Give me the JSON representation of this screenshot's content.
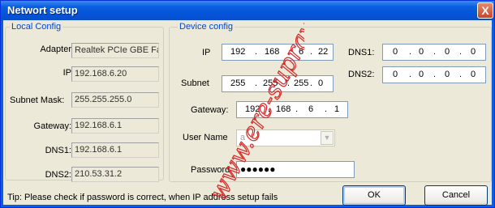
{
  "window": {
    "title": "Networt setup",
    "close_label": "X"
  },
  "local": {
    "legend": "Local Config",
    "fields": [
      {
        "label": "Adapter",
        "value": "Realtek PCIe GBE Fan"
      },
      {
        "label": "IP",
        "value": "192.168.6.20"
      },
      {
        "label": "Subnet Mask:",
        "value": "255.255.255.0"
      },
      {
        "label": "Gateway:",
        "value": "192.168.6.1"
      },
      {
        "label": "DNS1:",
        "value": "192.168.6.1"
      },
      {
        "label": "DNS2:",
        "value": "210.53.31.2"
      }
    ]
  },
  "device": {
    "legend": "Device config",
    "ip_label": "IP",
    "ip": [
      "192",
      "168",
      "6",
      "22"
    ],
    "subnet_label": "Subnet",
    "subnet": [
      "255",
      "255",
      "255",
      "0"
    ],
    "gateway_label": "Gateway:",
    "gateway": [
      "192",
      "168",
      "6",
      "1"
    ],
    "dns1_label": "DNS1:",
    "dns1": [
      "0",
      "0",
      "0",
      "0"
    ],
    "dns2_label": "DNS2:",
    "dns2": [
      "0",
      "0",
      "0",
      "0"
    ],
    "username_label": "User Name",
    "username_value": "a",
    "password_label": "Password",
    "password_value": "●●●●●●"
  },
  "tip": "Tip:  Please check if password is correct, when IP address setup fails",
  "buttons": {
    "ok": "OK",
    "cancel": "Cancel"
  },
  "watermark": "www.ere-supravegh"
}
